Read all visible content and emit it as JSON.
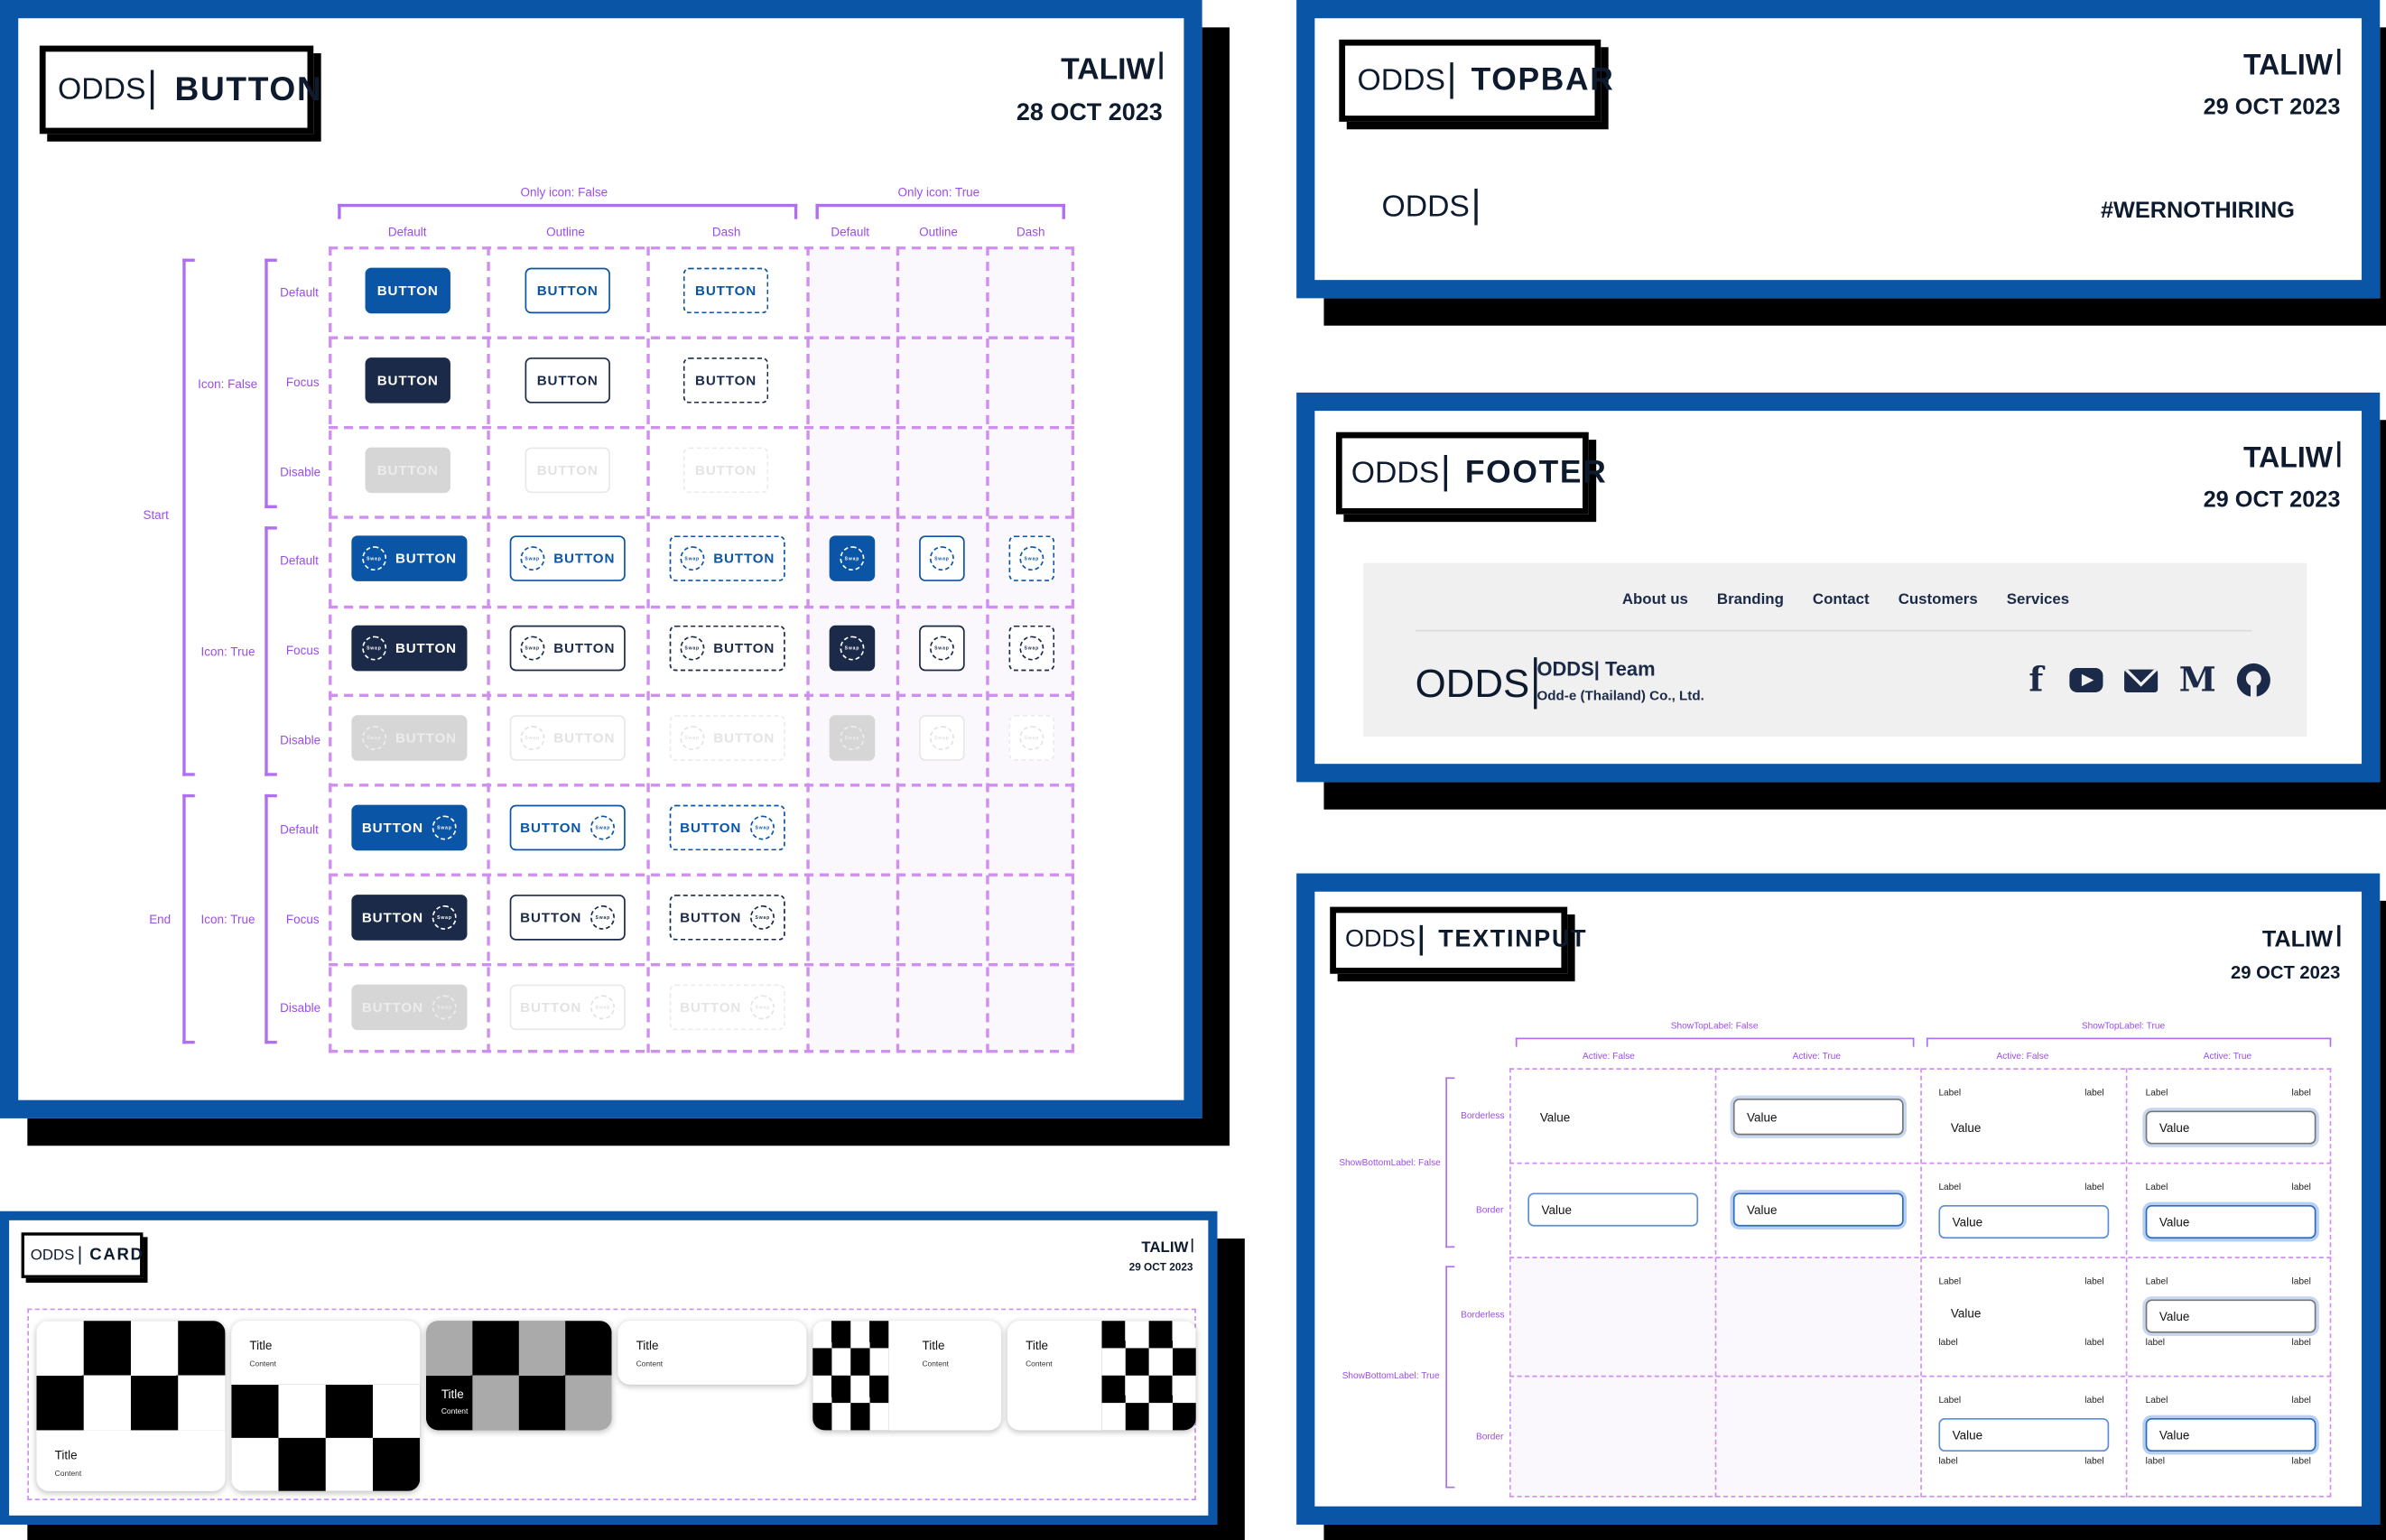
{
  "brand": {
    "logo": "ODDS",
    "author": "TALIW"
  },
  "button_panel": {
    "name": "BUTTON",
    "author": "TALIW",
    "date": "28 OCT 2023",
    "groups": {
      "only_icon_false": "Only icon: False",
      "only_icon_true": "Only icon: True"
    },
    "columns": [
      "Default",
      "Outline",
      "Dash",
      "Default",
      "Outline",
      "Dash"
    ],
    "states": [
      "Default",
      "Focus",
      "Disable"
    ],
    "icon_groups": [
      "Icon: False",
      "Icon: True",
      "Icon: True"
    ],
    "positions": [
      "Start",
      "End"
    ],
    "button_label": "BUTTON",
    "icon_label": "Swap"
  },
  "topbar_panel": {
    "name": "TOPBAR",
    "author": "TALIW",
    "date": "29 OCT 2023",
    "hashtag": "#WERNOTHIRING"
  },
  "footer_panel": {
    "name": "FOOTER",
    "author": "TALIW",
    "date": "29 OCT 2023",
    "links": [
      "About us",
      "Branding",
      "Contact",
      "Customers",
      "Services"
    ],
    "team": "ODDS| Team",
    "company": "Odd-e (Thailand) Co., Ltd.",
    "social_icons": [
      "facebook-icon",
      "youtube-icon",
      "mail-icon",
      "medium-icon",
      "github-icon"
    ]
  },
  "textinput_panel": {
    "name": "TEXTINPUT",
    "author": "TALIW",
    "date": "29 OCT 2023",
    "top_groups": [
      "ShowTopLabel: False",
      "ShowTopLabel: True"
    ],
    "active": [
      "Active: False",
      "Active: True",
      "Active: False",
      "Active: True"
    ],
    "row_groups": [
      "ShowBottomLabel: False",
      "ShowBottomLabel: True"
    ],
    "row_types": [
      "Borderless",
      "Border",
      "Borderless",
      "Border"
    ],
    "value": "Value",
    "label_upper": "Label",
    "label_lower": "label"
  },
  "card_panel": {
    "name": "CARD",
    "author": "TALIW",
    "date": "29 OCT 2023",
    "title": "Title",
    "content": "Content"
  },
  "colors": {
    "brand_blue": "#0a55a5",
    "navy": "#1b2a48",
    "purple": "#9b4de6"
  }
}
